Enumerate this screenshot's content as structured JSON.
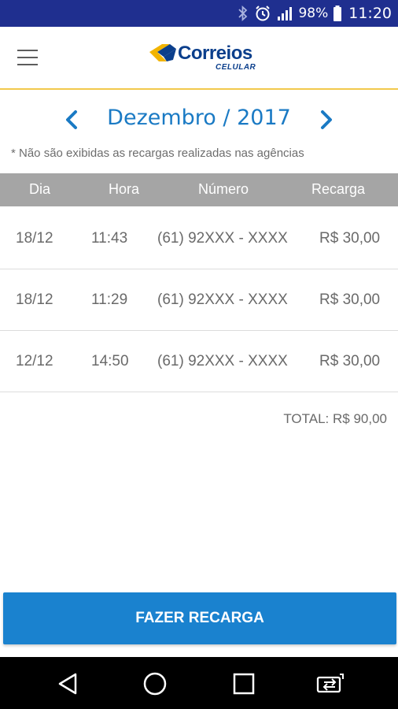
{
  "status_bar": {
    "battery_percent": "98%",
    "time": "11:20",
    "icons": [
      "bluetooth-icon",
      "alarm-icon",
      "signal-icon",
      "battery-icon"
    ]
  },
  "app_bar": {
    "brand": "Correios",
    "brand_sub": "CELULAR",
    "menu_icon": "hamburger-menu-icon",
    "colors": {
      "brand_blue": "#0b3f8c",
      "brand_yellow": "#f2b400",
      "divider": "#f2c94c"
    }
  },
  "month_selector": {
    "label": "Dezembro / 2017",
    "prev_icon": "chevron-left-icon",
    "next_icon": "chevron-right-icon",
    "color": "#1a7ac4"
  },
  "notice": "* Não são exibidas as recargas realizadas nas agências",
  "table": {
    "columns": [
      "Dia",
      "Hora",
      "Número",
      "Recarga"
    ],
    "rows": [
      {
        "dia": "18/12",
        "hora": "11:43",
        "numero": "(61) 92XXX - XXXX",
        "recarga": "R$ 30,00"
      },
      {
        "dia": "18/12",
        "hora": "11:29",
        "numero": "(61) 92XXX - XXXX",
        "recarga": "R$ 30,00"
      },
      {
        "dia": "12/12",
        "hora": "14:50",
        "numero": "(61) 92XXX - XXXX",
        "recarga": "R$ 30,00"
      }
    ]
  },
  "total": "TOTAL: R$ 90,00",
  "cta": {
    "label": "FAZER RECARGA",
    "color": "#1a82cf"
  },
  "nav_bar": {
    "icons": [
      "back-icon",
      "home-icon",
      "recents-icon",
      "switch-sim-icon"
    ]
  }
}
